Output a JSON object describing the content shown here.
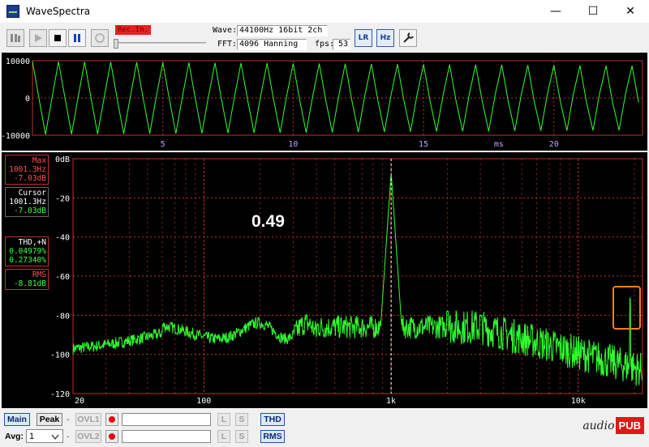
{
  "window": {
    "title": "WaveSpectra",
    "minimize": "—",
    "maximize": "☐",
    "close": "✕"
  },
  "toolbar": {
    "rec_in": "Rec.In.",
    "wave_label": "Wave:",
    "wave_value": "44100Hz 16bit 2ch",
    "fft_label": "FFT:",
    "fft_value": "4096 Hanning",
    "fps_label": "fps:",
    "fps_value": "53",
    "lr_icon_text": "LR",
    "hz_icon_text": "Hz"
  },
  "wave": {
    "y_ticks": [
      "10000",
      "0",
      "-10000"
    ],
    "x_ticks": [
      "5",
      "10",
      "15",
      "20"
    ],
    "x_unit": "ms",
    "color": "#30ff30"
  },
  "spectrum": {
    "db_ticks": [
      "0dB",
      "-20",
      "-40",
      "-60",
      "-80",
      "-100",
      "-120"
    ],
    "freq_ticks": [
      "20",
      "100",
      "1k",
      "10k"
    ],
    "peak_freq_hz": 1001.3,
    "peak_db": -7.03,
    "color": "#30ff30",
    "grid_color": "#c03030",
    "highlight_color": "#f08020"
  },
  "readouts": {
    "max_title": "Max",
    "max_freq": "1001.3Hz",
    "max_db": "-7.03dB",
    "cursor_title": "Cursor",
    "cursor_freq": "1001.3Hz",
    "cursor_db": "-7.03dB",
    "thd_title": "THD,+N",
    "thd_value": "0.04979%",
    "thdn_value": "0.27340%",
    "rms_title": "RMS",
    "rms_value": "-8.81dB"
  },
  "overlay_value": "0.49",
  "bottom": {
    "main": "Main",
    "peak": "Peak",
    "ovl1": "OVL1",
    "ovl2": "OVL2",
    "l": "L",
    "s": "S",
    "thd": "THD",
    "rms": "RMS",
    "avg_label": "Avg:",
    "avg_value": "1",
    "dash": "-"
  },
  "logo": {
    "left": "audio",
    "right": "PUB"
  }
}
